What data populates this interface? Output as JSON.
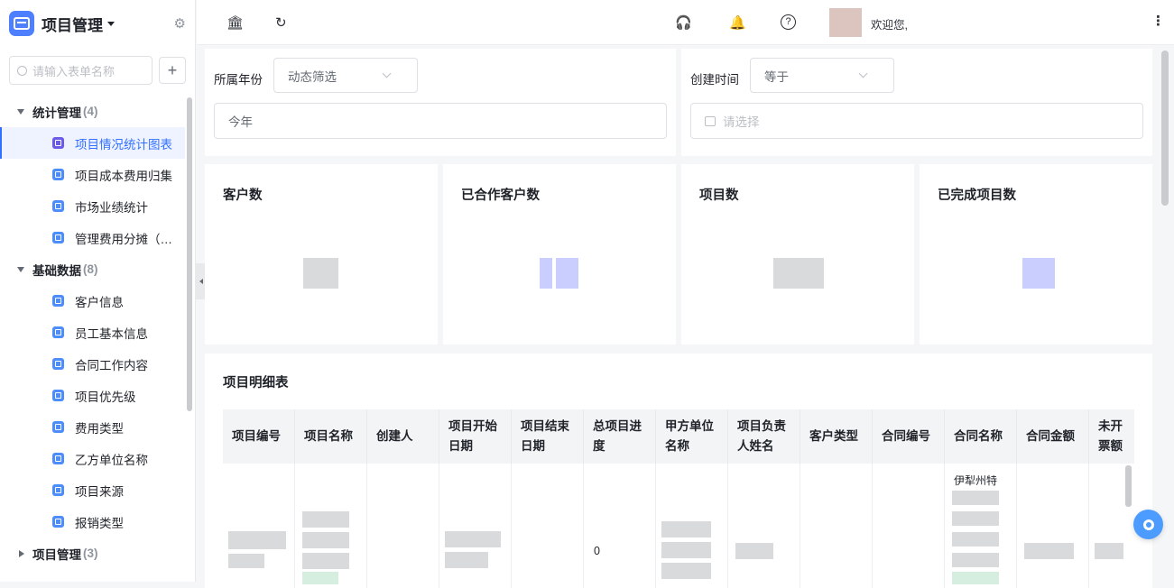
{
  "app": {
    "title": "项目管理"
  },
  "sidebar": {
    "search_placeholder": "请输入表单名称",
    "plus_label": "+",
    "groups": [
      {
        "label": "统计管理",
        "count": "(4)",
        "expanded": true,
        "items": [
          "项目情况统计图表",
          "项目成本费用归集",
          "市场业绩统计",
          "管理费用分摊（中心）"
        ]
      },
      {
        "label": "基础数据",
        "count": "(8)",
        "expanded": true,
        "items": [
          "客户信息",
          "员工基本信息",
          "合同工作内容",
          "项目优先级",
          "费用类型",
          "乙方单位名称",
          "项目来源",
          "报销类型"
        ]
      },
      {
        "label": "项目管理",
        "count": "(3)",
        "expanded": false,
        "items": []
      }
    ]
  },
  "topbar": {
    "welcome": "欢迎您,",
    "icons": [
      "bank-icon",
      "refresh-icon",
      "headset-icon",
      "bell-icon",
      "help-icon",
      "more-icon"
    ]
  },
  "filters": {
    "year": {
      "label": "所属年份",
      "mode": "动态筛选",
      "value": "今年"
    },
    "created": {
      "label": "创建时间",
      "mode": "等于",
      "placeholder": "请选择"
    }
  },
  "stats": [
    {
      "title": "客户数"
    },
    {
      "title": "已合作客户数"
    },
    {
      "title": "项目数"
    },
    {
      "title": "已完成项目数"
    }
  ],
  "table": {
    "title": "项目明细表",
    "columns": [
      "项目编号",
      "项目名称",
      "创建人",
      "项目开始日期",
      "项目结束日期",
      "总项目进度",
      "甲方单位名称",
      "项目负责人姓名",
      "客户类型",
      "合同编号",
      "合同名称",
      "合同金额",
      "未开票额"
    ],
    "row": {
      "progress": "0",
      "contract_name_prefix": "伊犁州特"
    }
  },
  "colors": {
    "accent": "#3370ff",
    "app_icon": "#4e7fff",
    "fab": "#4c9bff"
  }
}
